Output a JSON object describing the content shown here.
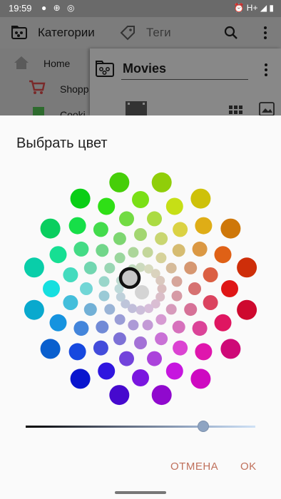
{
  "status_bar": {
    "time": "19:59",
    "network": "H+"
  },
  "app_bar": {
    "tab_categories": "Категории",
    "tab_tags": "Теги",
    "icons": [
      "category-icon",
      "tag-icon",
      "search-icon",
      "more-vert-icon"
    ]
  },
  "left_panel": {
    "items": [
      {
        "label": "Home",
        "icon": "home-icon"
      },
      {
        "label": "Shopp",
        "icon": "cart-icon"
      },
      {
        "label": "Cooki",
        "icon": "book-icon"
      }
    ]
  },
  "right_panel": {
    "title": "Movies",
    "icons": [
      "category-icon",
      "more-vert-icon",
      "film-icon",
      "grid-view-icon",
      "image-icon"
    ]
  },
  "dialog": {
    "title": "Выбрать цвет",
    "selected_color": "#c8c8c8",
    "lightness_fraction": 0.76,
    "cancel_label": "ОТМЕНА",
    "ok_label": "OK"
  },
  "colors": {
    "accent": "#c0715c",
    "dialog_bg": "#fafafa",
    "scrim": "#7a7a7a"
  }
}
